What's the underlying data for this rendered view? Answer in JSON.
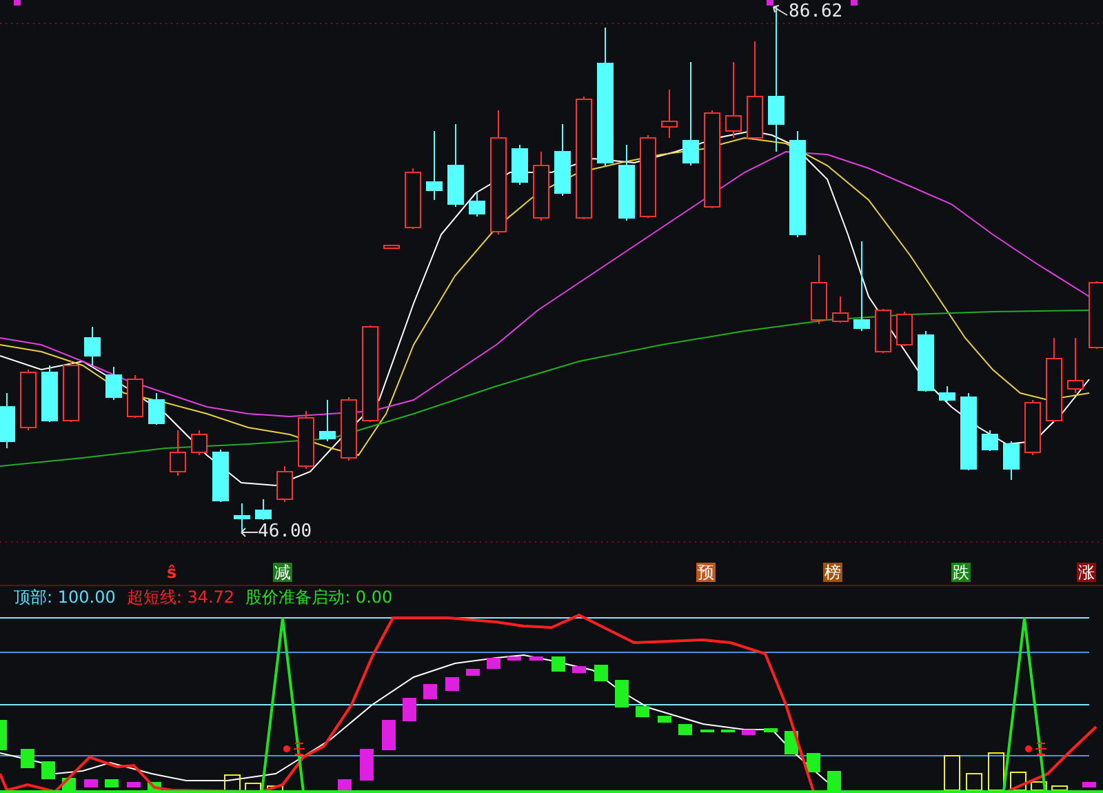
{
  "price_chart": {
    "high_label": "86.62",
    "low_label": "46.00"
  },
  "signals": [
    {
      "label": "ŝ",
      "kind": "text",
      "color": "#ff2a2a"
    },
    {
      "label": "减",
      "kind": "badge",
      "color": "#1f7a1f"
    },
    {
      "label": "预",
      "kind": "badge",
      "color": "#c4551a"
    },
    {
      "label": "榜",
      "kind": "badge",
      "color": "#a0520f"
    },
    {
      "label": "跌",
      "kind": "badge",
      "color": "#128a12"
    },
    {
      "label": "涨",
      "kind": "badge",
      "color": "#8a0c0c"
    }
  ],
  "indicator_legend": [
    {
      "text": "顶部: 100.00",
      "color": "#55e0ff"
    },
    {
      "text": "超短线: 34.72",
      "color": "#ff2020"
    },
    {
      "text": "股价准备启动: 0.00",
      "color": "#20e020"
    }
  ]
}
